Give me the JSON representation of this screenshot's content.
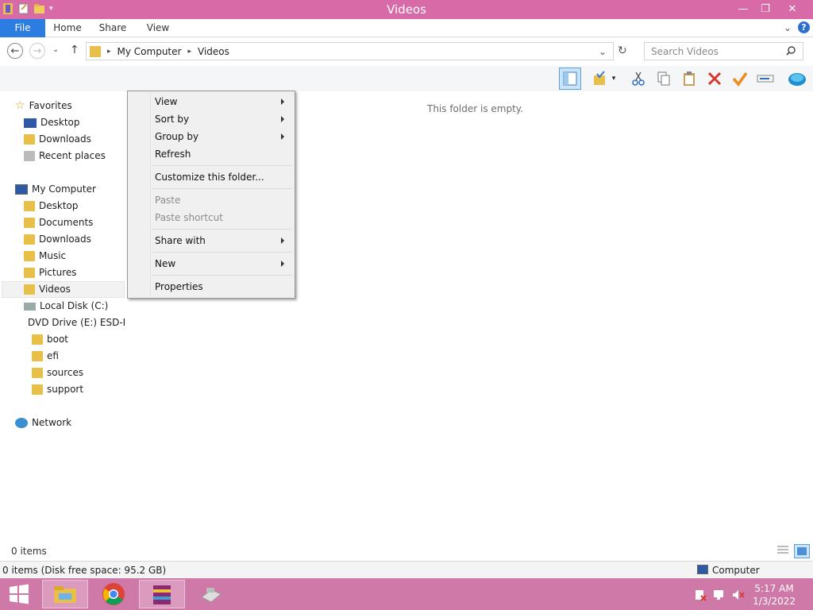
{
  "window": {
    "title": "Videos",
    "minimize": "—",
    "restore": "❐",
    "close": "✕"
  },
  "ribbon": {
    "tabs": [
      "File",
      "Home",
      "Share",
      "View"
    ],
    "expand": "⌄",
    "help": "?"
  },
  "address": {
    "back": "←",
    "forward": "→",
    "recent": "⌄",
    "up": "↑",
    "crumbs": [
      "My Computer",
      "Videos"
    ],
    "dropdown": "⌄",
    "refresh": "↻"
  },
  "search": {
    "placeholder": "Search Videos",
    "icon": "search-icon"
  },
  "nav": {
    "favorites": "Favorites",
    "fav_items": [
      "Desktop",
      "Downloads",
      "Recent places"
    ],
    "computer": "My Computer",
    "computer_items": [
      "Desktop",
      "Documents",
      "Downloads",
      "Music",
      "Pictures",
      "Videos",
      "Local Disk (C:)",
      "DVD Drive (E:) ESD-ISO"
    ],
    "dvd_items": [
      "boot",
      "efi",
      "sources",
      "support"
    ],
    "network": "Network"
  },
  "content": {
    "empty": "This folder is empty."
  },
  "context_menu": {
    "items": [
      "View",
      "Sort by",
      "Group by",
      "Refresh",
      "Customize this folder...",
      "Paste",
      "Paste shortcut",
      "Share with",
      "New",
      "Properties"
    ]
  },
  "status": {
    "items": "0 items",
    "detail": "0 items (Disk free space: 95.2 GB)",
    "location": "Computer"
  },
  "clock": {
    "time": "5:17 AM",
    "date": "1/3/2022"
  },
  "colors": {
    "titlebar": "#d76aa7",
    "file_tab": "#2b7de2",
    "taskbar": "#cf79a8"
  }
}
